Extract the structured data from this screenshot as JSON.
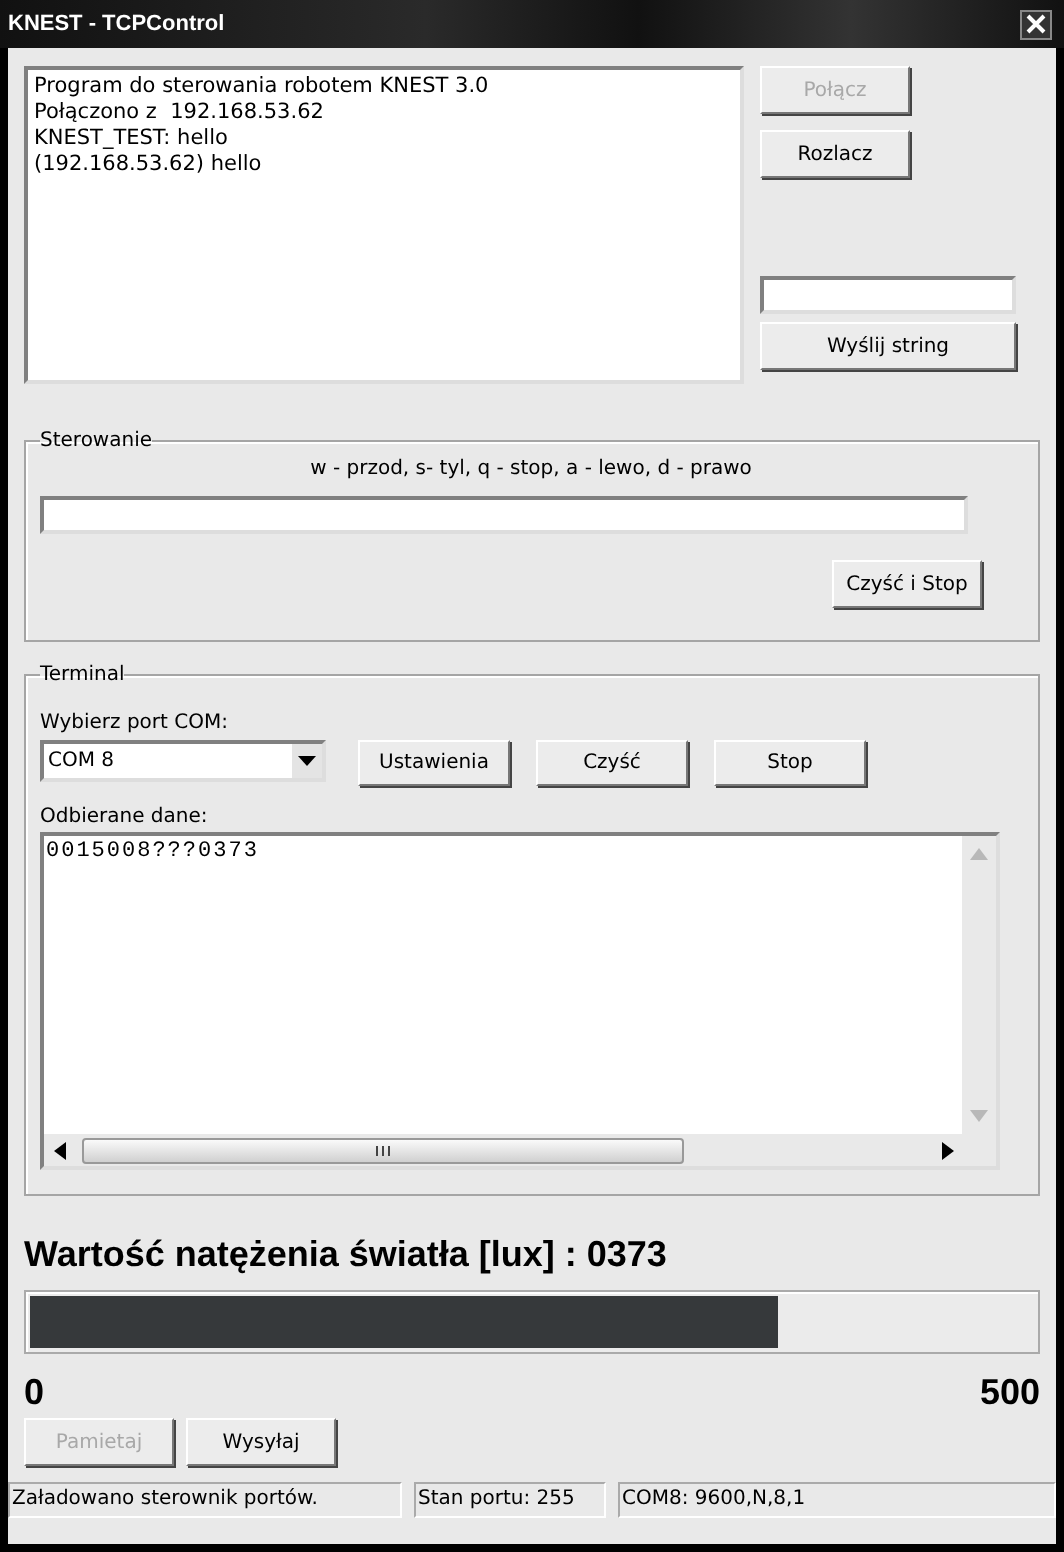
{
  "window": {
    "title": "KNEST - TCPControl"
  },
  "log": {
    "lines": [
      "Program do sterowania robotem KNEST 3.0",
      "Połączono z  192.168.53.62",
      "KNEST_TEST: hello",
      "(192.168.53.62) hello"
    ]
  },
  "connection_buttons": [
    {
      "label": "Połącz",
      "disabled": true
    },
    {
      "label": "Rozlacz",
      "disabled": false
    }
  ],
  "send": {
    "button": "Wyślij string"
  },
  "control": {
    "title": "Sterowanie",
    "hint": "w - przod, s- tyl, q - stop, a - lewo, d - prawo",
    "button": "Czyść i Stop"
  },
  "terminal": {
    "title": "Terminal",
    "port_label": "Wybierz port COM:",
    "port_value": "COM 8",
    "buttons": [
      {
        "label": "Ustawienia"
      },
      {
        "label": "Czyść"
      },
      {
        "label": "Stop"
      }
    ],
    "received_label": "Odbierane dane:",
    "received_text": "0015008???0373"
  },
  "light": {
    "title": "Wartość natężenia światła [lux] : 0373",
    "level": 0.746,
    "min_label": "0",
    "max_label": "500"
  },
  "bottom_buttons": [
    {
      "label": "Pamietaj",
      "disabled": true
    },
    {
      "label": "Wysyłaj",
      "disabled": false
    }
  ],
  "status_bar": [
    "Załadowano sterownik portów.",
    "Stan portu: 255",
    "COM8: 9600,N,8,1"
  ]
}
